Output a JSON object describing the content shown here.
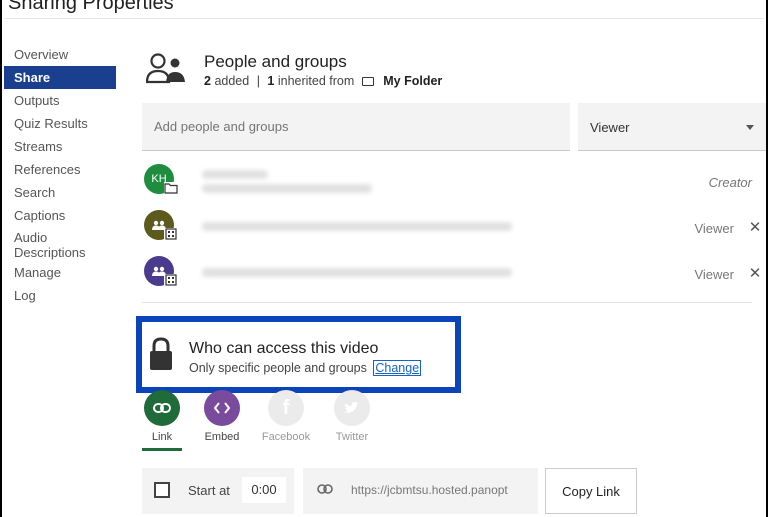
{
  "header": {
    "cut_title": "Sharing Properties"
  },
  "sidebar": {
    "items": [
      {
        "label": "Overview"
      },
      {
        "label": "Share"
      },
      {
        "label": "Outputs"
      },
      {
        "label": "Quiz Results"
      },
      {
        "label": "Streams"
      },
      {
        "label": "References"
      },
      {
        "label": "Search"
      },
      {
        "label": "Captions"
      },
      {
        "label": "Audio Descriptions"
      },
      {
        "label": "Manage"
      },
      {
        "label": "Log"
      }
    ],
    "active": "Share"
  },
  "people_groups": {
    "title": "People and groups",
    "added_count": "2",
    "added_text": "added",
    "inherited_count": "1",
    "inherited_text": "inherited from",
    "folder_name": "My Folder"
  },
  "add_people": {
    "placeholder": "Add people and groups"
  },
  "role_select": {
    "value": "Viewer"
  },
  "people": [
    {
      "initials": "KH",
      "role": "Creator",
      "avatar_color": "#1e8e3e",
      "badge": "folder-icon"
    },
    {
      "initials": "",
      "role": "Viewer",
      "avatar_color": "#5c5a1c",
      "badge": "building-icon"
    },
    {
      "initials": "",
      "role": "Viewer",
      "avatar_color": "#4a3b8c",
      "badge": "building-icon"
    }
  ],
  "access": {
    "title": "Who can access this video",
    "subtitle": "Only specific people and groups",
    "change_label": "Change"
  },
  "share_options": {
    "link": "Link",
    "embed": "Embed",
    "facebook": "Facebook",
    "twitter": "Twitter"
  },
  "start_at": {
    "label": "Start at",
    "value": "0:00"
  },
  "url": {
    "value": "https://jcbmtsu.hosted.panopt"
  },
  "copy_link": {
    "label": "Copy Link"
  },
  "colors": {
    "accent": "#1a3f8f",
    "highlight_border": "#0a44b8",
    "link_green": "#1f6b3a",
    "embed_purple": "#7a4a9c"
  }
}
